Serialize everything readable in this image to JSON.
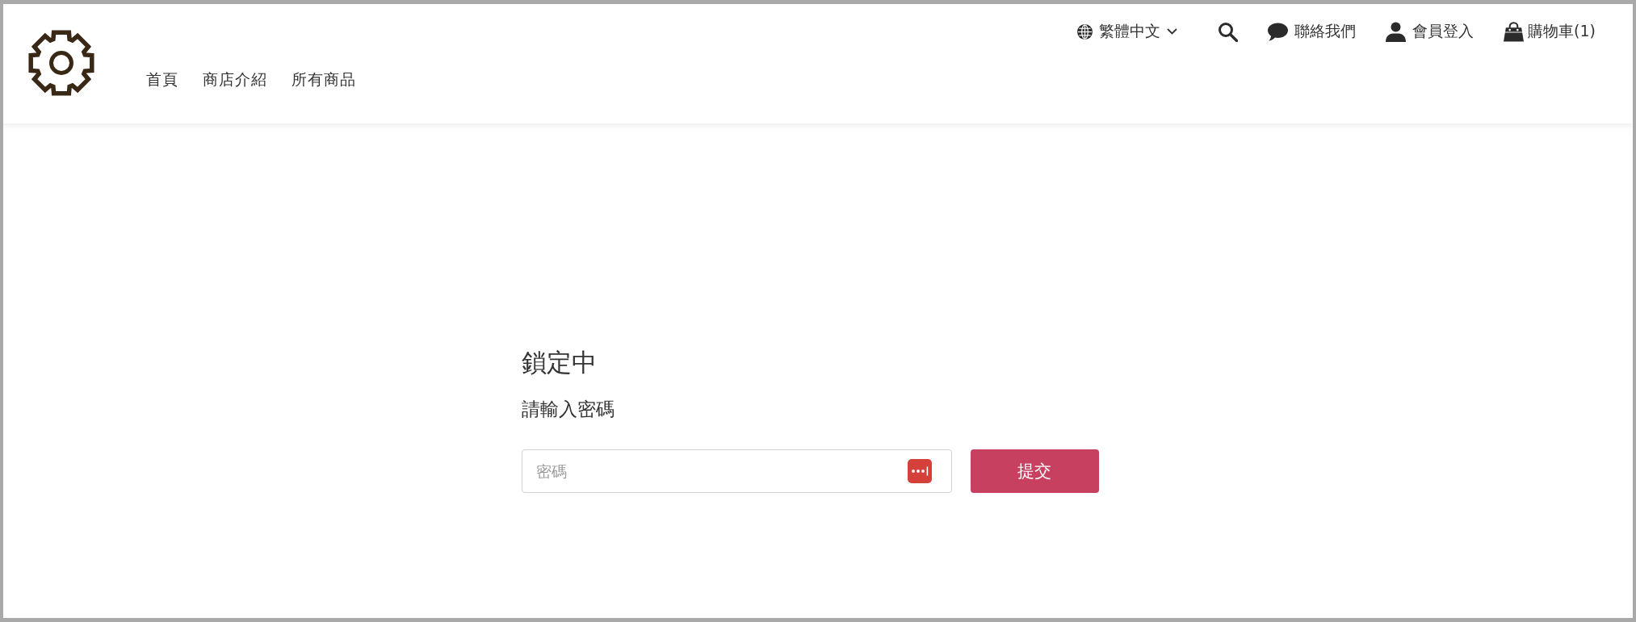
{
  "header": {
    "utility_links": [
      {
        "kind": "language",
        "label": "繁體中文"
      },
      {
        "kind": "search"
      },
      {
        "kind": "contact",
        "label": "聯絡我們"
      },
      {
        "kind": "login",
        "label": "會員登入"
      },
      {
        "kind": "cart",
        "label": "購物車(1)"
      }
    ],
    "nav": [
      {
        "label": "首頁"
      },
      {
        "label": "商店介紹"
      },
      {
        "label": "所有商品"
      }
    ]
  },
  "lock_form": {
    "title": "鎖定中",
    "prompt": "請輸入密碼",
    "password_field": {
      "placeholder": "密碼"
    },
    "submit_button": "提交"
  }
}
